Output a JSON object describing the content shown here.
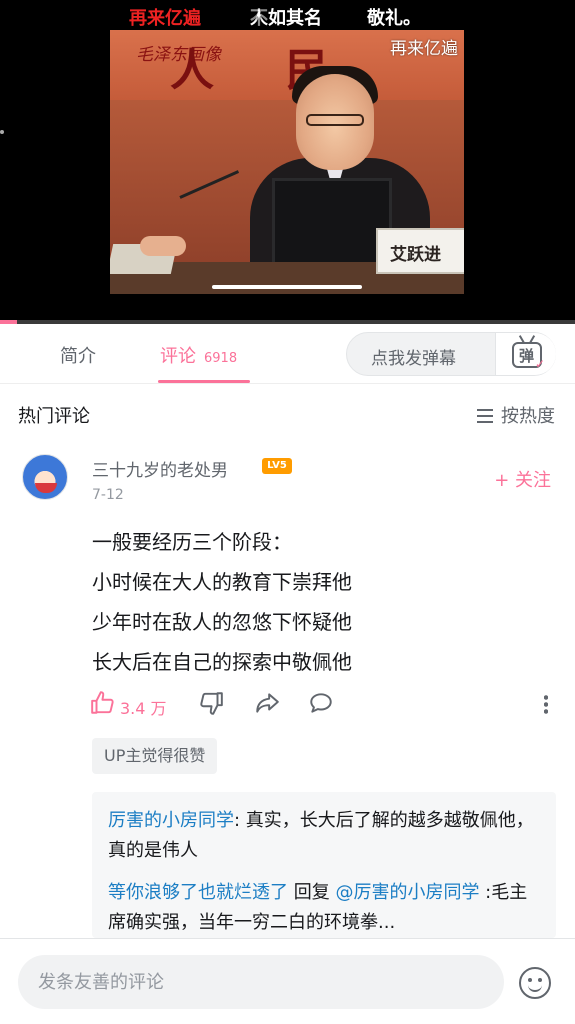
{
  "player": {
    "danmaku": [
      {
        "text": "再来亿遍",
        "color": "#ee2222"
      },
      {
        "text": "人如其名",
        "color": "#ffffff"
      },
      {
        "text": "不如",
        "color": "#ffffff"
      },
      {
        "text": "敬礼。",
        "color": "#ffffff"
      }
    ],
    "watermark": "再来亿遍",
    "scene": {
      "banner_text": "人 民 万",
      "banner_calligraphy": "毛泽东画像",
      "nameplate": "艾跃进"
    },
    "progress_fraction": 0.03
  },
  "tabs": {
    "intro_label": "简介",
    "comments_label": "评论",
    "comments_count": "6918",
    "danmaku_placeholder": "点我发弹幕",
    "danmaku_icon_glyph": "弹"
  },
  "comments_section": {
    "title": "热门评论",
    "sort_label": "按热度",
    "sort_icon": "list-icon"
  },
  "comment": {
    "username": "三十九岁的老处男",
    "level": "LV5",
    "date": "7-12",
    "follow_label": "+ 关注",
    "lines": [
      "一般要经历三个阶段：",
      "小时候在大人的教育下崇拜他",
      "少年时在敌人的忽悠下怀疑他",
      "长大后在自己的探索中敬佩他"
    ],
    "like_count": "3.4 万",
    "up_badge": "UP主觉得很赞",
    "replies": [
      {
        "user": "厉害的小房同学",
        "separator": ": ",
        "text": "真实，长大后了解的越多越敬佩他，真的是伟人"
      },
      {
        "user": "等你浪够了也就烂透了",
        "mid": " 回复 ",
        "target": "@厉害的小房同学",
        "text": " :毛主席确实强，当年一穷二白的环境拳..."
      }
    ]
  },
  "bottom": {
    "input_placeholder": "发条友善的评论"
  },
  "colors": {
    "accent": "#fb7299",
    "link": "#1c7ec4",
    "level_badge": "#ff9c00"
  }
}
